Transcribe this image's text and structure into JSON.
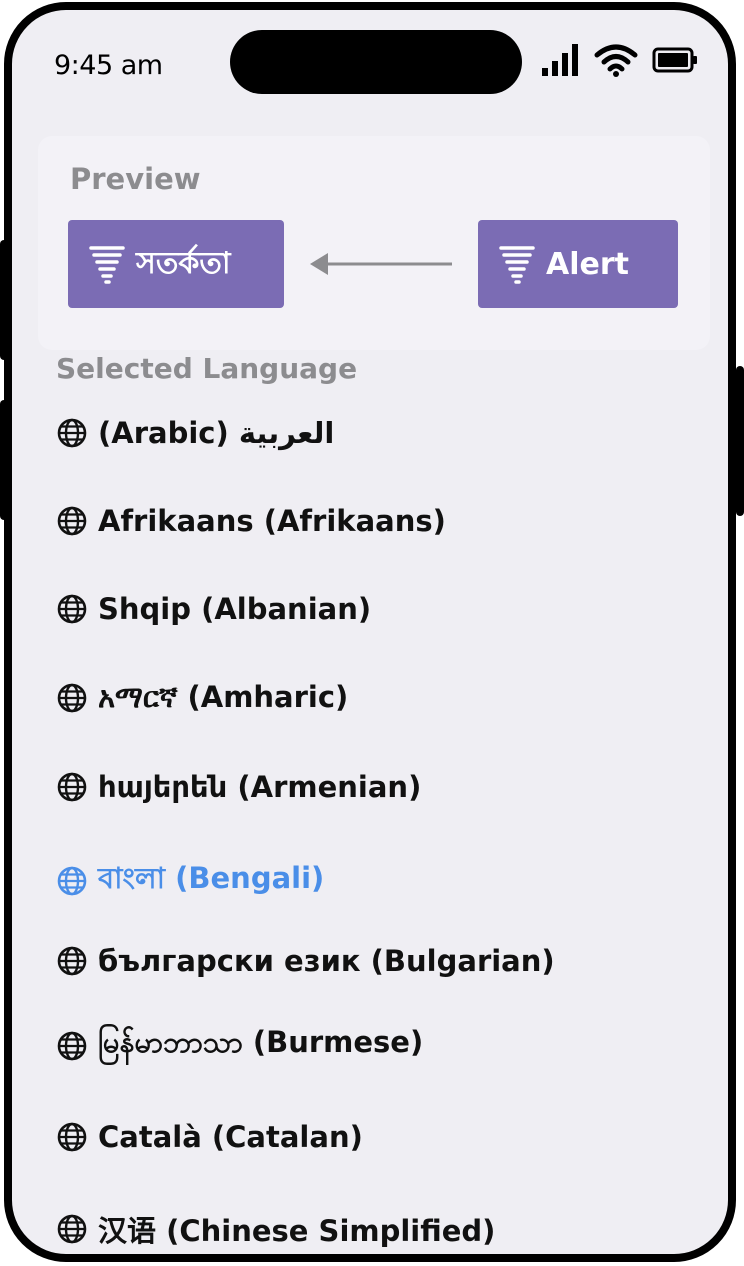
{
  "status_bar": {
    "time": "9:45 am"
  },
  "preview": {
    "label": "Preview",
    "translated_chip": {
      "icon": "tornado-icon",
      "label": "সতর্কতা"
    },
    "source_chip": {
      "icon": "tornado-icon",
      "label": "Alert"
    },
    "arrow_icon": "arrow-left-icon",
    "chip_color": "#7b6cb4"
  },
  "languages": {
    "title": "Selected Language",
    "selected_color": "#4a8ee8",
    "items": [
      {
        "label": "(Arabic) العربية",
        "selected": false
      },
      {
        "label": "Afrikaans (Afrikaans)",
        "selected": false
      },
      {
        "label": "Shqip (Albanian)",
        "selected": false
      },
      {
        "label": "አማርኛ (Amharic)",
        "selected": false
      },
      {
        "label": "հայերեն (Armenian)",
        "selected": false
      },
      {
        "label": "বাংলা (Bengali)",
        "selected": true
      },
      {
        "label": "български език (Bulgarian)",
        "selected": false
      },
      {
        "label": "မြန်မာဘာသာ (Burmese)",
        "selected": false
      },
      {
        "label": "Català (Catalan)",
        "selected": false
      },
      {
        "label": "汉语 (Chinese Simplified)",
        "selected": false
      }
    ]
  }
}
